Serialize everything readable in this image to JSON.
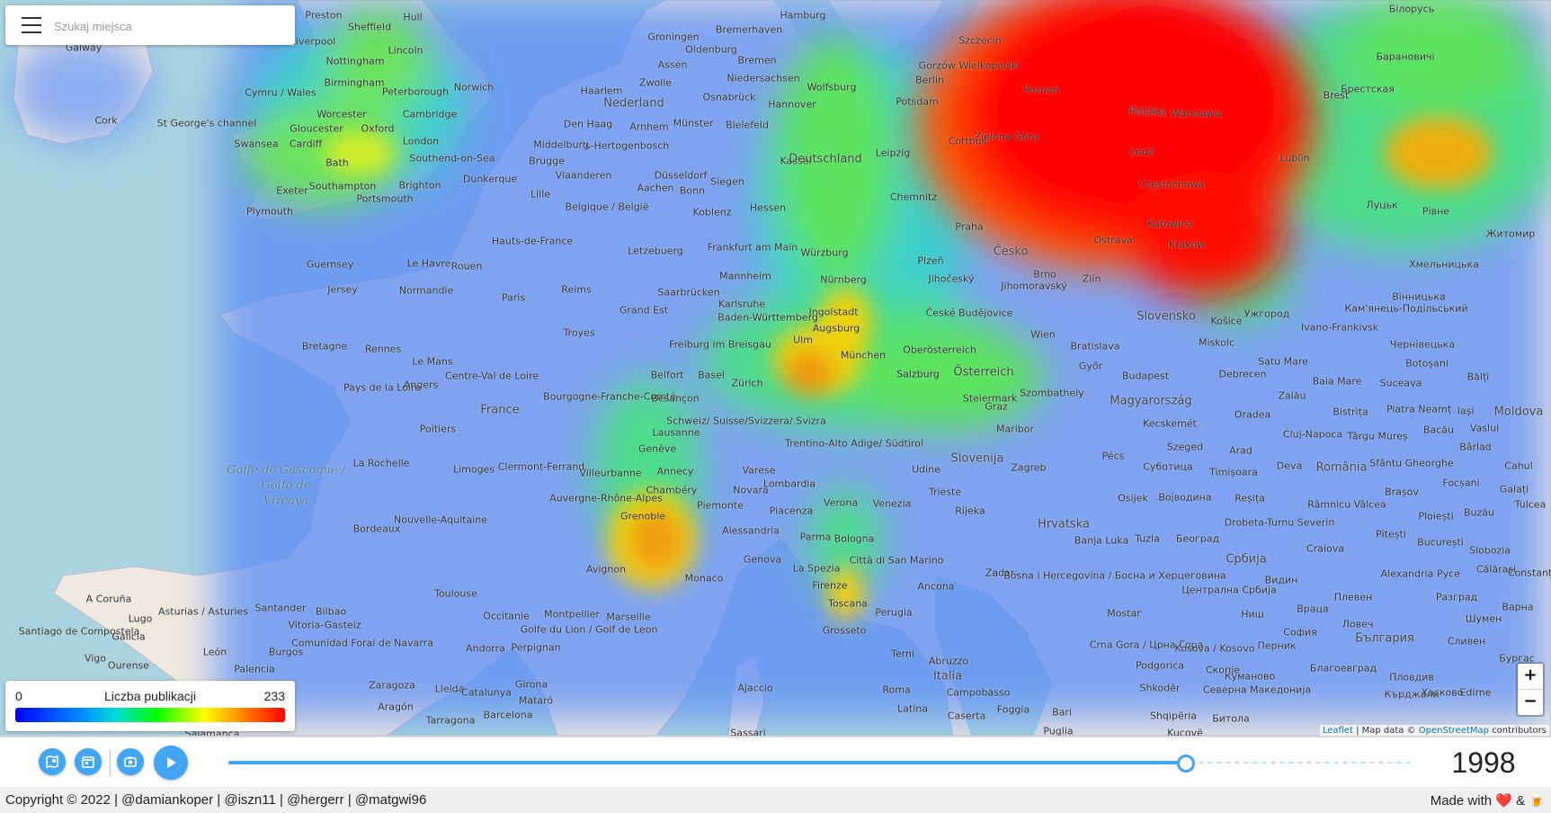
{
  "search": {
    "placeholder": "Szukaj miejsca",
    "value": ""
  },
  "legend": {
    "min": "0",
    "max": "233",
    "title": "Liczba publikacji"
  },
  "zoom": {
    "in": "+",
    "out": "−"
  },
  "attribution": {
    "leaflet": "Leaflet",
    "separator": "| Map data ©",
    "osm": "OpenStreetMap",
    "contributors": "contributors"
  },
  "controls": {
    "year": "1998",
    "slider_progress": 0.81
  },
  "footer": {
    "copyright": "Copyright © 2022 | @damiankoper | @iszn11 | @hergerr | @matgwi96",
    "made_with": "Made with",
    "heart": "❤️",
    "amp": "&",
    "beer": "🍺"
  },
  "colors": {
    "accent": "#42a5f5",
    "heat_high": "#ff0000",
    "heat_low": "#0000ff"
  },
  "icons": [
    "menu-icon",
    "map-icon",
    "calendar-icon",
    "camera-icon",
    "play-icon"
  ],
  "map": {
    "places": [
      {
        "name": "Preston"
      },
      {
        "name": "Sheffield"
      },
      {
        "name": "Hull"
      },
      {
        "name": "Liverpool"
      },
      {
        "name": "Galway"
      },
      {
        "name": "Lincoln"
      },
      {
        "name": "Nottingham"
      },
      {
        "name": "Birmingham"
      },
      {
        "name": "Peterborough"
      },
      {
        "name": "Norwich"
      },
      {
        "name": "Cymru / Wales"
      },
      {
        "name": "Worcester"
      },
      {
        "name": "Cambridge"
      },
      {
        "name": "Cork"
      },
      {
        "name": "St George's channel"
      },
      {
        "name": "Gloucester"
      },
      {
        "name": "Oxford"
      },
      {
        "name": "Swansea"
      },
      {
        "name": "Cardiff"
      },
      {
        "name": "London"
      },
      {
        "name": "Southend-on-Sea"
      },
      {
        "name": "Bath"
      },
      {
        "name": "Southampton"
      },
      {
        "name": "Brighton"
      },
      {
        "name": "Exeter"
      },
      {
        "name": "Portsmouth"
      },
      {
        "name": "Plymouth"
      },
      {
        "name": "Hamburg"
      },
      {
        "name": "Groningen"
      },
      {
        "name": "Bremerhaven"
      },
      {
        "name": "Oldenburg"
      },
      {
        "name": "Assen"
      },
      {
        "name": "Bremen"
      },
      {
        "name": "Niedersachsen"
      },
      {
        "name": "Zwolle"
      },
      {
        "name": "Wolfsburg"
      },
      {
        "name": "Haarlem"
      },
      {
        "name": "Nederland"
      },
      {
        "name": "Osnabrück"
      },
      {
        "name": "Hannover"
      },
      {
        "name": "Berlin"
      },
      {
        "name": "Potsdam"
      },
      {
        "name": "Den Haag"
      },
      {
        "name": "Arnhem"
      },
      {
        "name": "Münster"
      },
      {
        "name": "Bielefeld"
      },
      {
        "name": "Middelburg"
      },
      {
        "name": "'s-Hertogenbosch"
      },
      {
        "name": "Kassel"
      },
      {
        "name": "Leipzig"
      },
      {
        "name": "Deutschland"
      },
      {
        "name": "Brugge"
      },
      {
        "name": "Vlaanderen"
      },
      {
        "name": "Düsseldorf"
      },
      {
        "name": "Dunkerque"
      },
      {
        "name": "Aachen"
      },
      {
        "name": "Bonn"
      },
      {
        "name": "Siegen"
      },
      {
        "name": "Lille"
      },
      {
        "name": "Belgique / België"
      },
      {
        "name": "Chemnitz"
      },
      {
        "name": "Koblenz"
      },
      {
        "name": "Hessen"
      },
      {
        "name": "Frankfurt am Main"
      },
      {
        "name": "Praha"
      },
      {
        "name": "Würzburg"
      },
      {
        "name": "Letzebuerg"
      },
      {
        "name": "Guernsey"
      },
      {
        "name": "Le Havre"
      },
      {
        "name": "Rouen"
      },
      {
        "name": "Hauts-de-France"
      },
      {
        "name": "Jersey"
      },
      {
        "name": "Mannheim"
      },
      {
        "name": "Nürnberg"
      },
      {
        "name": "Normandie"
      },
      {
        "name": "Reims"
      },
      {
        "name": "Saarbrücken"
      },
      {
        "name": "Paris"
      },
      {
        "name": "Karlsruhe"
      },
      {
        "name": "Ingolstadt"
      },
      {
        "name": "Baden-Württemberg"
      },
      {
        "name": "Augsburg"
      },
      {
        "name": "Grand Est"
      },
      {
        "name": "Brest"
      },
      {
        "name": "Troyes"
      },
      {
        "name": "Bretagne"
      },
      {
        "name": "Rennes"
      },
      {
        "name": "Freiburg im Breisgau"
      },
      {
        "name": "Ulm"
      },
      {
        "name": "München"
      },
      {
        "name": "Le Mans"
      },
      {
        "name": "Centre-Val de Loire"
      },
      {
        "name": "Belfort"
      },
      {
        "name": "Basel"
      },
      {
        "name": "Salzburg"
      },
      {
        "name": "Angers"
      },
      {
        "name": "Pays de la Loire"
      },
      {
        "name": "Bourgogne-Franche-Comté"
      },
      {
        "name": "Besançon"
      },
      {
        "name": "Zürich"
      },
      {
        "name": "France"
      },
      {
        "name": "Schweiz/ Suisse/Svizzera/ Svizra"
      },
      {
        "name": "Poitiers"
      },
      {
        "name": "Lausanne"
      },
      {
        "name": "Genève"
      },
      {
        "name": "La Rochelle"
      },
      {
        "name": "Limoges"
      },
      {
        "name": "Clermont-Ferrand"
      },
      {
        "name": "Villeurbanne"
      },
      {
        "name": "Annecy"
      },
      {
        "name": "Chambéry"
      },
      {
        "name": "Auvergne-Rhône-Alpes"
      },
      {
        "name": "Nouvelle-Aquitaine"
      },
      {
        "name": "Grenoble"
      },
      {
        "name": "Bordeaux"
      },
      {
        "name": "Avignon"
      },
      {
        "name": "Monaco"
      },
      {
        "name": "Toulouse"
      },
      {
        "name": "Montpellier"
      },
      {
        "name": "Occitanie"
      },
      {
        "name": "Marseille"
      },
      {
        "name": "Golfe du Lion / Golf de Leon"
      },
      {
        "name": "A Coruña"
      },
      {
        "name": "Santander"
      },
      {
        "name": "Bilbao"
      },
      {
        "name": "Lugo"
      },
      {
        "name": "Asturias / Asturies"
      },
      {
        "name": "Santiago de Compostela"
      },
      {
        "name": "Vitoria-Gasteiz"
      },
      {
        "name": "Galicia"
      },
      {
        "name": "Comunidad Foral de Navarra"
      },
      {
        "name": "Vigo"
      },
      {
        "name": "Ourense"
      },
      {
        "name": "León"
      },
      {
        "name": "Burgos"
      },
      {
        "name": "Andorra"
      },
      {
        "name": "Perpignan"
      },
      {
        "name": "Palencia"
      },
      {
        "name": "Zaragoza"
      },
      {
        "name": "Lleida"
      },
      {
        "name": "Girona"
      },
      {
        "name": "Catalunya"
      },
      {
        "name": "Mataró"
      },
      {
        "name": "Aragón"
      },
      {
        "name": "Tarragona"
      },
      {
        "name": "Barcelona"
      },
      {
        "name": "Salamanca"
      },
      {
        "name": "Lombardia"
      },
      {
        "name": "Novara"
      },
      {
        "name": "Varese"
      },
      {
        "name": "Verona"
      },
      {
        "name": "Venezia"
      },
      {
        "name": "Piemonte"
      },
      {
        "name": "Piacenza"
      },
      {
        "name": "Alessandria"
      },
      {
        "name": "Parma"
      },
      {
        "name": "Bologna"
      },
      {
        "name": "Genova"
      },
      {
        "name": "La Spezia"
      },
      {
        "name": "Città di San Marino"
      },
      {
        "name": "Firenze"
      },
      {
        "name": "Toscana"
      },
      {
        "name": "Perugia"
      },
      {
        "name": "Grosseto"
      },
      {
        "name": "Ancona"
      },
      {
        "name": "Terni"
      },
      {
        "name": "Italia"
      },
      {
        "name": "Abruzzo"
      },
      {
        "name": "Roma"
      },
      {
        "name": "Campobasso"
      },
      {
        "name": "Ajaccio"
      },
      {
        "name": "Latina"
      },
      {
        "name": "Caserta"
      },
      {
        "name": "Foggia"
      },
      {
        "name": "Bari"
      },
      {
        "name": "Sassari"
      },
      {
        "name": "Puglia"
      },
      {
        "name": "Udine"
      },
      {
        "name": "Trieste"
      },
      {
        "name": "Trentino-Alto Adige/ Südtirol"
      },
      {
        "name": "Slovenija"
      },
      {
        "name": "Rijeka"
      },
      {
        "name": "Zagreb"
      },
      {
        "name": "Hrvatska"
      },
      {
        "name": "Zadar"
      },
      {
        "name": "Banja Luka"
      },
      {
        "name": "Tuzla"
      },
      {
        "name": "Bosna i Hercegovina / Босна и Херцеговина"
      },
      {
        "name": "Mostar"
      },
      {
        "name": "Crna Gora / Црна Гора"
      },
      {
        "name": "Kosova / Kosovo"
      },
      {
        "name": "Shqipëria"
      },
      {
        "name": "Podgorica"
      },
      {
        "name": "Shkodër"
      },
      {
        "name": "Osijek"
      },
      {
        "name": "Pécs"
      },
      {
        "name": "Szeged"
      },
      {
        "name": "Kecskemét"
      },
      {
        "name": "Magyarország"
      },
      {
        "name": "Budapest"
      },
      {
        "name": "Győr"
      },
      {
        "name": "Szombathely"
      },
      {
        "name": "Maribor"
      },
      {
        "name": "Graz"
      },
      {
        "name": "Steiermark"
      },
      {
        "name": "Oberösterreich"
      },
      {
        "name": "Österreich"
      },
      {
        "name": "Wien"
      },
      {
        "name": "Bratislava"
      },
      {
        "name": "Slovensko"
      },
      {
        "name": "Košice"
      },
      {
        "name": "Miskolc"
      },
      {
        "name": "Debrecen"
      },
      {
        "name": "Ужгород"
      },
      {
        "name": "České Budějovice"
      },
      {
        "name": "Česko"
      },
      {
        "name": "Plzeň"
      },
      {
        "name": "Jihočeský"
      },
      {
        "name": "Jihomoravský"
      },
      {
        "name": "Brno"
      },
      {
        "name": "Zlín"
      },
      {
        "name": "Ostrava"
      },
      {
        "name": "Katowice"
      },
      {
        "name": "Częstochowa"
      },
      {
        "name": "Kraków"
      },
      {
        "name": "Polska"
      },
      {
        "name": "Warszawa"
      },
      {
        "name": "Łódź"
      },
      {
        "name": "Poznań"
      },
      {
        "name": "Szczecin"
      },
      {
        "name": "Gorzów Wielkopolski"
      },
      {
        "name": "Zielona Góra"
      },
      {
        "name": "Cottbus"
      },
      {
        "name": "Lublin"
      },
      {
        "name": "Brest"
      },
      {
        "name": "Білорусь"
      },
      {
        "name": "Барановичі"
      },
      {
        "name": "Брестская"
      },
      {
        "name": "Луцьк"
      },
      {
        "name": "Рівне"
      },
      {
        "name": "Житомир"
      },
      {
        "name": "Хмельницька"
      },
      {
        "name": "Кам'янець-Подільський"
      },
      {
        "name": "Вінницька"
      },
      {
        "name": "Чернівецька"
      },
      {
        "name": "Ivano-Frankivsk"
      },
      {
        "name": "Satu Mare"
      },
      {
        "name": "Baia Mare"
      },
      {
        "name": "Zalău"
      },
      {
        "name": "Oradea"
      },
      {
        "name": "Bistrița"
      },
      {
        "name": "Suceava"
      },
      {
        "name": "Botoșani"
      },
      {
        "name": "Bălți"
      },
      {
        "name": "Iași"
      },
      {
        "name": "Moldova"
      },
      {
        "name": "Piatra Neamț"
      },
      {
        "name": "Bacău"
      },
      {
        "name": "Vaslui"
      },
      {
        "name": "Cluj-Napoca"
      },
      {
        "name": "Târgu Mureș"
      },
      {
        "name": "Bârlad"
      },
      {
        "name": "Sfântu Gheorghe"
      },
      {
        "name": "Arad"
      },
      {
        "name": "Timișoara"
      },
      {
        "name": "Deva"
      },
      {
        "name": "România"
      },
      {
        "name": "Brașov"
      },
      {
        "name": "Focșani"
      },
      {
        "name": "Cahul"
      },
      {
        "name": "Galați"
      },
      {
        "name": "Tulcea"
      },
      {
        "name": "Reșița"
      },
      {
        "name": "Râmnicu Vâlcea"
      },
      {
        "name": "Ploiești"
      },
      {
        "name": "Buzău"
      },
      {
        "name": "Drobeta-Turnu Severin"
      },
      {
        "name": "Pitești"
      },
      {
        "name": "București"
      },
      {
        "name": "Slobozia"
      },
      {
        "name": "Craiova"
      },
      {
        "name": "Călărași"
      },
      {
        "name": "Constanța"
      },
      {
        "name": "Alexandria"
      },
      {
        "name": "Русе"
      },
      {
        "name": "Видин"
      },
      {
        "name": "Плевен"
      },
      {
        "name": "Разград"
      },
      {
        "name": "Варна"
      },
      {
        "name": "Враца"
      },
      {
        "name": "Ловеч"
      },
      {
        "name": "Шумен"
      },
      {
        "name": "Бургас"
      },
      {
        "name": "Сливен"
      },
      {
        "name": "София"
      },
      {
        "name": "България"
      },
      {
        "name": "Перник"
      },
      {
        "name": "Ниш"
      },
      {
        "name": "Србија"
      },
      {
        "name": "Београд"
      },
      {
        "name": "Суботица"
      },
      {
        "name": "Војводина"
      },
      {
        "name": "Централна Србија"
      },
      {
        "name": "Куманово"
      },
      {
        "name": "Благоевград"
      },
      {
        "name": "Пловдив"
      },
      {
        "name": "Хасково"
      },
      {
        "name": "Кърджали"
      },
      {
        "name": "Edirne"
      },
      {
        "name": "Северна Македонија"
      },
      {
        "name": "Битола"
      },
      {
        "name": "Скопје"
      },
      {
        "name": "Kuçovë"
      }
    ],
    "countries_big": [
      {
        "name": "Deutschland"
      },
      {
        "name": "Polska"
      },
      {
        "name": "France"
      }
    ],
    "seas": [
      {
        "name": "Golfe de Gascogne /\nGolfo de\nVizcaya"
      }
    ]
  }
}
